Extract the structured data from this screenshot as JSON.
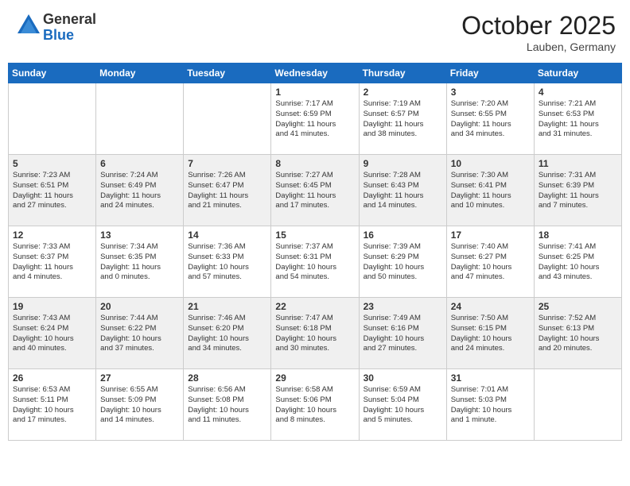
{
  "header": {
    "logo_general": "General",
    "logo_blue": "Blue",
    "month_title": "October 2025",
    "location": "Lauben, Germany"
  },
  "weekdays": [
    "Sunday",
    "Monday",
    "Tuesday",
    "Wednesday",
    "Thursday",
    "Friday",
    "Saturday"
  ],
  "weeks": [
    [
      {
        "day": "",
        "info": ""
      },
      {
        "day": "",
        "info": ""
      },
      {
        "day": "",
        "info": ""
      },
      {
        "day": "1",
        "info": "Sunrise: 7:17 AM\nSunset: 6:59 PM\nDaylight: 11 hours\nand 41 minutes."
      },
      {
        "day": "2",
        "info": "Sunrise: 7:19 AM\nSunset: 6:57 PM\nDaylight: 11 hours\nand 38 minutes."
      },
      {
        "day": "3",
        "info": "Sunrise: 7:20 AM\nSunset: 6:55 PM\nDaylight: 11 hours\nand 34 minutes."
      },
      {
        "day": "4",
        "info": "Sunrise: 7:21 AM\nSunset: 6:53 PM\nDaylight: 11 hours\nand 31 minutes."
      }
    ],
    [
      {
        "day": "5",
        "info": "Sunrise: 7:23 AM\nSunset: 6:51 PM\nDaylight: 11 hours\nand 27 minutes."
      },
      {
        "day": "6",
        "info": "Sunrise: 7:24 AM\nSunset: 6:49 PM\nDaylight: 11 hours\nand 24 minutes."
      },
      {
        "day": "7",
        "info": "Sunrise: 7:26 AM\nSunset: 6:47 PM\nDaylight: 11 hours\nand 21 minutes."
      },
      {
        "day": "8",
        "info": "Sunrise: 7:27 AM\nSunset: 6:45 PM\nDaylight: 11 hours\nand 17 minutes."
      },
      {
        "day": "9",
        "info": "Sunrise: 7:28 AM\nSunset: 6:43 PM\nDaylight: 11 hours\nand 14 minutes."
      },
      {
        "day": "10",
        "info": "Sunrise: 7:30 AM\nSunset: 6:41 PM\nDaylight: 11 hours\nand 10 minutes."
      },
      {
        "day": "11",
        "info": "Sunrise: 7:31 AM\nSunset: 6:39 PM\nDaylight: 11 hours\nand 7 minutes."
      }
    ],
    [
      {
        "day": "12",
        "info": "Sunrise: 7:33 AM\nSunset: 6:37 PM\nDaylight: 11 hours\nand 4 minutes."
      },
      {
        "day": "13",
        "info": "Sunrise: 7:34 AM\nSunset: 6:35 PM\nDaylight: 11 hours\nand 0 minutes."
      },
      {
        "day": "14",
        "info": "Sunrise: 7:36 AM\nSunset: 6:33 PM\nDaylight: 10 hours\nand 57 minutes."
      },
      {
        "day": "15",
        "info": "Sunrise: 7:37 AM\nSunset: 6:31 PM\nDaylight: 10 hours\nand 54 minutes."
      },
      {
        "day": "16",
        "info": "Sunrise: 7:39 AM\nSunset: 6:29 PM\nDaylight: 10 hours\nand 50 minutes."
      },
      {
        "day": "17",
        "info": "Sunrise: 7:40 AM\nSunset: 6:27 PM\nDaylight: 10 hours\nand 47 minutes."
      },
      {
        "day": "18",
        "info": "Sunrise: 7:41 AM\nSunset: 6:25 PM\nDaylight: 10 hours\nand 43 minutes."
      }
    ],
    [
      {
        "day": "19",
        "info": "Sunrise: 7:43 AM\nSunset: 6:24 PM\nDaylight: 10 hours\nand 40 minutes."
      },
      {
        "day": "20",
        "info": "Sunrise: 7:44 AM\nSunset: 6:22 PM\nDaylight: 10 hours\nand 37 minutes."
      },
      {
        "day": "21",
        "info": "Sunrise: 7:46 AM\nSunset: 6:20 PM\nDaylight: 10 hours\nand 34 minutes."
      },
      {
        "day": "22",
        "info": "Sunrise: 7:47 AM\nSunset: 6:18 PM\nDaylight: 10 hours\nand 30 minutes."
      },
      {
        "day": "23",
        "info": "Sunrise: 7:49 AM\nSunset: 6:16 PM\nDaylight: 10 hours\nand 27 minutes."
      },
      {
        "day": "24",
        "info": "Sunrise: 7:50 AM\nSunset: 6:15 PM\nDaylight: 10 hours\nand 24 minutes."
      },
      {
        "day": "25",
        "info": "Sunrise: 7:52 AM\nSunset: 6:13 PM\nDaylight: 10 hours\nand 20 minutes."
      }
    ],
    [
      {
        "day": "26",
        "info": "Sunrise: 6:53 AM\nSunset: 5:11 PM\nDaylight: 10 hours\nand 17 minutes."
      },
      {
        "day": "27",
        "info": "Sunrise: 6:55 AM\nSunset: 5:09 PM\nDaylight: 10 hours\nand 14 minutes."
      },
      {
        "day": "28",
        "info": "Sunrise: 6:56 AM\nSunset: 5:08 PM\nDaylight: 10 hours\nand 11 minutes."
      },
      {
        "day": "29",
        "info": "Sunrise: 6:58 AM\nSunset: 5:06 PM\nDaylight: 10 hours\nand 8 minutes."
      },
      {
        "day": "30",
        "info": "Sunrise: 6:59 AM\nSunset: 5:04 PM\nDaylight: 10 hours\nand 5 minutes."
      },
      {
        "day": "31",
        "info": "Sunrise: 7:01 AM\nSunset: 5:03 PM\nDaylight: 10 hours\nand 1 minute."
      },
      {
        "day": "",
        "info": ""
      }
    ]
  ]
}
